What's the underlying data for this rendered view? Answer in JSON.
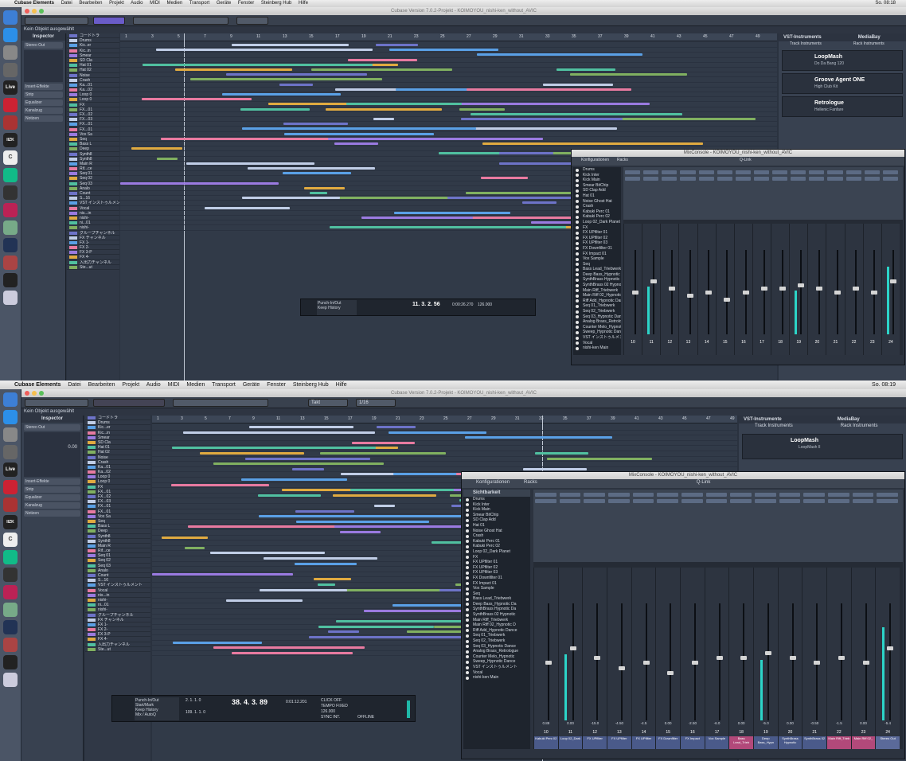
{
  "top": {
    "menubar": {
      "app": "Cubase Elements",
      "items": [
        "Datei",
        "Bearbeiten",
        "Projekt",
        "Audio",
        "MIDI",
        "Medien",
        "Transport",
        "Geräte",
        "Fenster",
        "Steinberg Hub",
        "Hilfe"
      ],
      "clock": "So. 08:18"
    },
    "window_title": "Cubase Version 7.0.2-Projekt - KOIMOYOU_nishi-ken_without_AVIC",
    "status": "Kein Objekt ausgewählt",
    "inspector": {
      "title": "Inspector",
      "output": "Stereo Out",
      "sections": [
        "Insert-Effekte",
        "Strip",
        "Equalizer",
        "Kanalzug",
        "Notizen"
      ]
    },
    "tracks": [
      "コードトラ",
      "Drums",
      "Kic..er",
      "Kic..in",
      "Smear",
      "SD Cla",
      "Hat 01",
      "Hat 02",
      "Noise",
      "Crash",
      "Ka...01",
      "Ka...02",
      "Loop 0",
      "Loop 0",
      "FX",
      "FX...01",
      "FX...02",
      "FX...03",
      "FX...01",
      "FX...01",
      "Vox Sa",
      "Seq",
      "Bass L",
      "Deep",
      "Synth8",
      "Synth8",
      "Main R",
      "Rif...ce",
      "Seq 01",
      "Seq 02",
      "Seq 03",
      "Analo",
      "Count",
      "S...16",
      "VST インストゥルメント",
      "Vocal",
      "nis...in",
      "nishi-",
      "ni...01",
      "nishi-",
      "グループチャンネル",
      "FX チャンネル",
      "FX 1-",
      "FX 2-",
      "FX 3-P",
      "FX 4-",
      "入出力チャンネル",
      "Ste...ut"
    ],
    "ruler": [
      "1",
      "3",
      "5",
      "7",
      "9",
      "11",
      "13",
      "15",
      "17",
      "19",
      "21",
      "23",
      "25",
      "27",
      "29",
      "31",
      "33",
      "35",
      "37",
      "39",
      "41",
      "43",
      "45",
      "47",
      "49"
    ],
    "vst": {
      "tab": "VST-Instruments",
      "mediabay": "MediaBay",
      "rack": "Track Instruments",
      "rack2": "Rack Instruments",
      "items": [
        {
          "name": "LoopMash",
          "plugin": "LoopMash II",
          "preset": "Do Da Bang 120"
        },
        {
          "name": "Groove Agent ONE",
          "plugin": "Groove Agent ONE",
          "preset": "High Club Kit"
        },
        {
          "name": "Retrologue",
          "plugin": "Retrologue II",
          "preset": "Hellenic Fanfare"
        }
      ]
    },
    "mixconsole": {
      "title": "MixConsole - KOIMOYOU_nishi-ken_without_AVIC",
      "konfig": "Konfigurationen",
      "racks": "Racks",
      "qlink": "Q-Link",
      "group": "Group"
    },
    "transport": {
      "punch": "Punch-In/Out",
      "marker": "Start/Mark",
      "keep": "Keep History",
      "mix": "Mix / AutoQ",
      "time": "11. 3. 2. 56",
      "secs": "0:00:26.270",
      "tempo": "126.000",
      "click": "CLICK OFF"
    }
  },
  "bottom": {
    "menubar": {
      "app": "Cubase Elements",
      "items": [
        "Datei",
        "Bearbeiten",
        "Projekt",
        "Audio",
        "MIDI",
        "Medien",
        "Transport",
        "Geräte",
        "Fenster",
        "Steinberg Hub",
        "Hilfe"
      ],
      "clock": "So. 08:19"
    },
    "window_title": "Cubase Version 7.0.2-Projekt - KOIMOYOU_nishi-ken_without_AVIC",
    "status": "Kein Objekt ausgewählt",
    "grid": "Takt",
    "quant": "1/16",
    "inspector": {
      "title": "Inspector",
      "output": "Stereo Out",
      "volume": "0.00",
      "sections": [
        "Insert-Effekte",
        "Strip",
        "Equalizer",
        "Kanalzug",
        "Notizen"
      ]
    },
    "tracks": [
      "コードトラ",
      "Drums",
      "Kic...er",
      "Kic...in",
      "Smear",
      "SD Cla",
      "Hat 01",
      "Hat 02",
      "Noise",
      "Crash",
      "Ka...01",
      "Ka...02",
      "Loop 0",
      "Loop 0",
      "FX",
      "FX...01",
      "FX...02",
      "FX...03",
      "FX...01",
      "FX...01",
      "Vox Sa",
      "Seq",
      "Bass L",
      "Deep",
      "Synth8",
      "Synth8",
      "Main R",
      "Rif...ce",
      "Seq 01",
      "Seq 02",
      "Seq 03",
      "Analo",
      "Count",
      "S...16",
      "VST インストゥルメント",
      "Vocal",
      "nis...in",
      "nishi-",
      "ni...01",
      "nishi-",
      "グループチャンネル",
      "FX チャンネル",
      "FX 1-",
      "FX 2-",
      "FX 3-P",
      "FX 4-",
      "入出力チャンネル",
      "Ste...ut"
    ],
    "ruler": [
      "1",
      "3",
      "5",
      "7",
      "9",
      "11",
      "13",
      "15",
      "17",
      "19",
      "21",
      "23",
      "25",
      "27",
      "29",
      "31",
      "33",
      "35",
      "37",
      "39",
      "41",
      "43",
      "45",
      "47",
      "49"
    ],
    "vst": {
      "tab": "VST-Instrumente",
      "mediabay": "MediaBay",
      "rack": "Track Instruments",
      "rack2": "Rack Instruments",
      "items": [
        {
          "name": "LoopMash",
          "plugin": "LoopMash II",
          "preset": ""
        }
      ]
    },
    "mixconsole": {
      "title": "MixConsole - KOIMOYOU_nishi-ken_without_AVIC",
      "konfig": "Konfigurationen",
      "racks": "Racks",
      "qlink": "Q-Link",
      "group": "Group",
      "visibility": "Sichtbarkeit"
    },
    "visibility_rows": [
      "Drums",
      "Kick Inter",
      "Kick Main",
      "Smear BitChip",
      "SD Clap Add",
      "Hat 01",
      "Noise Ghost Hat",
      "Crash",
      "Kabuki Perc 01",
      "Kabuki Perc 02",
      "Loop 02_Dark Planet",
      "FX",
      "FX UPfilter 01",
      "FX UPfilter 02",
      "FX UPfilter 03",
      "FX Downfilter 01",
      "FX Impact 01",
      "Vox Sample",
      "Seq",
      "Bass Lead_Triebwerk",
      "Deep Bass_Hypnotic Da",
      "SynthBrass Hypnotic Da",
      "SynthBrass 02 Hypnotic",
      "Main Riff_Triebwerk",
      "Main Riff 02_Hypnotic D",
      "Riff Add_Hypnotic Dance",
      "Seq 01_Triebwerk",
      "Seq 02_Triebwerk",
      "Seq 03_Hypnotic Dance",
      "Analog Brass_Retrologue",
      "Counter Melo_Hypnotic",
      "Sweep_Hypnotic Dance",
      "VST インストゥルメント",
      "Vocal",
      "nishi-ken Main"
    ],
    "channels": [
      {
        "num": "10",
        "name": "Kabuki Perc 02",
        "level": 0.0,
        "fader": 0.55
      },
      {
        "num": "11",
        "name": "Loop 02_Dark",
        "level": 0.6,
        "fader": 0.7
      },
      {
        "num": "12",
        "name": "FX UPfilter",
        "level": 0.0,
        "fader": 0.6
      },
      {
        "num": "13",
        "name": "FX UPfilter",
        "level": 0.0,
        "fader": 0.5
      },
      {
        "num": "14",
        "name": "FX UPfilter",
        "level": 0.0,
        "fader": 0.55
      },
      {
        "num": "15",
        "name": "FX Downfilter",
        "level": 0.0,
        "fader": 0.45
      },
      {
        "num": "16",
        "name": "FX Impact",
        "level": 0.0,
        "fader": 0.55
      },
      {
        "num": "17",
        "name": "Vox Sample",
        "level": 0.0,
        "fader": 0.6
      },
      {
        "num": "18",
        "name": "Bass Lead_Trieb",
        "level": 0.0,
        "fader": 0.6
      },
      {
        "num": "19",
        "name": "Deep Bass_Hypn",
        "level": 0.55,
        "fader": 0.65
      },
      {
        "num": "20",
        "name": "SynthBrass Hypnotic",
        "level": 0.0,
        "fader": 0.6
      },
      {
        "num": "21",
        "name": "SynthBrass 02",
        "level": 0.0,
        "fader": 0.55
      },
      {
        "num": "22",
        "name": "Main Riff_Trieb",
        "level": 0.0,
        "fader": 0.6
      },
      {
        "num": "23",
        "name": "Main Riff 02_",
        "level": 0.0,
        "fader": 0.55
      },
      {
        "num": "24",
        "name": "Stereo Out",
        "level": 0.85,
        "fader": 0.7
      }
    ],
    "values": [
      "0.89",
      "0.00",
      "-15.0",
      "-4.50",
      "-4.5",
      "0.00",
      "-2.50",
      "-6.0",
      "0.00",
      "-5.0",
      "0.00",
      "-0.50",
      "-1.5",
      "0.00",
      "-5.4"
    ],
    "transport": {
      "punch": "Punch-In/Out",
      "marker": "Start/Mark",
      "keep": "Keep History",
      "mix": "Mix / AutoQ",
      "pos1": "2. 1. 1. 0",
      "pos2": "109. 1. 1. 0",
      "time": "38. 4. 3. 89",
      "secs": "0:01:12.201",
      "tempo": "126.000",
      "click": "CLICK OFF",
      "tempo_label": "TEMPO FIXED",
      "sig": "4/4",
      "sync": "SYNC INT.",
      "offline": "OFFLINE"
    },
    "colors": {
      "accent": "#7b6bd6",
      "meter": "#2cd4c8",
      "orange": "#f0a030"
    }
  }
}
